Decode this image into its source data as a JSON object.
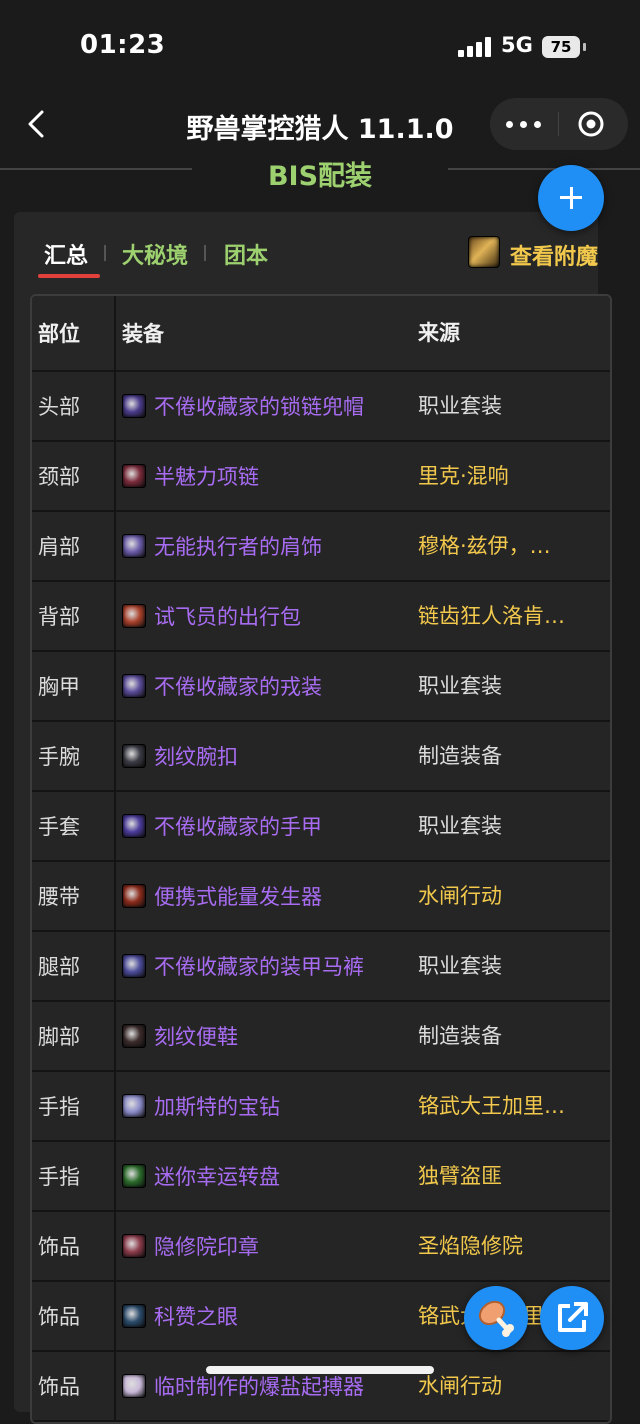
{
  "status": {
    "time": "01:23",
    "network": "5G",
    "battery": "75"
  },
  "nav": {
    "title": "野兽掌控猎人 11.1.0"
  },
  "subtitle": "BIS配装",
  "tabs": [
    {
      "label": "汇总",
      "active": true
    },
    {
      "label": "大秘境",
      "active": false
    },
    {
      "label": "团本",
      "active": false
    }
  ],
  "enchant": {
    "label": "查看附魔"
  },
  "table": {
    "headers": {
      "slot": "部位",
      "item": "装备",
      "source": "来源"
    },
    "rows": [
      {
        "slot": "头部",
        "item": "不倦收藏家的锁链兜帽",
        "source": "职业套装",
        "source_color": "#dcdcdc",
        "icon_color": "#4a3a8a"
      },
      {
        "slot": "颈部",
        "item": "半魅力项链",
        "source": "里克·混响",
        "source_color": "#f2c94c",
        "icon_color": "#7a2a3a"
      },
      {
        "slot": "肩部",
        "item": "无能执行者的肩饰",
        "source": "穆格·兹伊，…",
        "source_color": "#f2c94c",
        "icon_color": "#6a5aa8"
      },
      {
        "slot": "背部",
        "item": "试飞员的出行包",
        "source": "链齿狂人洛肯…",
        "source_color": "#f2c94c",
        "icon_color": "#a8402a"
      },
      {
        "slot": "胸甲",
        "item": "不倦收藏家的戎装",
        "source": "职业套装",
        "source_color": "#dcdcdc",
        "icon_color": "#5a4a98"
      },
      {
        "slot": "手腕",
        "item": "刻纹腕扣",
        "source": "制造装备",
        "source_color": "#dcdcdc",
        "icon_color": "#3a3a44"
      },
      {
        "slot": "手套",
        "item": "不倦收藏家的手甲",
        "source": "职业套装",
        "source_color": "#dcdcdc",
        "icon_color": "#4a3a9a"
      },
      {
        "slot": "腰带",
        "item": "便携式能量发生器",
        "source": "水闸行动",
        "source_color": "#f2c94c",
        "icon_color": "#8a2a1a"
      },
      {
        "slot": "腿部",
        "item": "不倦收藏家的装甲马裤",
        "source": "职业套装",
        "source_color": "#dcdcdc",
        "icon_color": "#4a4a9a"
      },
      {
        "slot": "脚部",
        "item": "刻纹便鞋",
        "source": "制造装备",
        "source_color": "#dcdcdc",
        "icon_color": "#3a2a2a"
      },
      {
        "slot": "手指",
        "item": "加斯特的宝钻",
        "source": "铬武大王加里…",
        "source_color": "#f2c94c",
        "icon_color": "#8a8ac8"
      },
      {
        "slot": "手指",
        "item": "迷你幸运转盘",
        "source": "独臂盗匪",
        "source_color": "#f2c94c",
        "icon_color": "#2a6a2a"
      },
      {
        "slot": "饰品",
        "item": "隐修院印章",
        "source": "圣焰隐修院",
        "source_color": "#f2c94c",
        "icon_color": "#8a3a4a"
      },
      {
        "slot": "饰品",
        "item": "科赞之眼",
        "source": "铬武大王加里…",
        "source_color": "#f2c94c",
        "icon_color": "#2a4a6a"
      },
      {
        "slot": "饰品",
        "item": "临时制作的爆盐起搏器",
        "source": "水闸行动",
        "source_color": "#f2c94c",
        "icon_color": "#c8b8d8"
      }
    ]
  },
  "colors": {
    "accent_blue": "#1f8ff5",
    "item_purple": "#a86cf2",
    "source_gold": "#f2c94c",
    "tab_green": "#9dd16f",
    "underline_red": "#e2403a"
  }
}
